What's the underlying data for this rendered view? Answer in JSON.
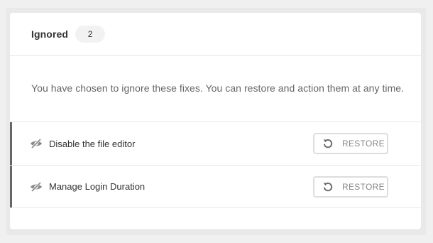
{
  "header": {
    "title": "Ignored",
    "count": "2"
  },
  "description": "You have chosen to ignore these fixes. You can restore and action them at any time.",
  "items": [
    {
      "label": "Disable the file editor",
      "icon": "eye-slash-icon",
      "action_label": "RESTORE",
      "action_icon": "undo-icon"
    },
    {
      "label": "Manage Login Duration",
      "icon": "eye-slash-icon",
      "action_label": "RESTORE",
      "action_icon": "undo-icon"
    }
  ],
  "colors": {
    "accent_bar": "#666666",
    "button_border": "#dddddd",
    "button_text": "#888888"
  }
}
